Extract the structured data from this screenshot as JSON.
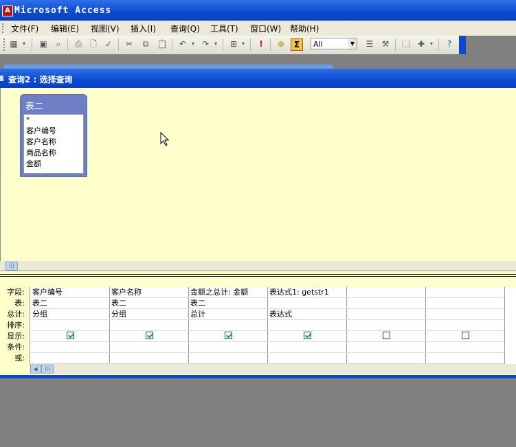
{
  "app": {
    "title": "Microsoft Access",
    "icon": "access-key-icon"
  },
  "menu": [
    "文件(F)",
    "编辑(E)",
    "视图(V)",
    "插入(I)",
    "查询(Q)",
    "工具(T)",
    "窗口(W)",
    "帮助(H)"
  ],
  "toolbar": {
    "top_values_combo": "All",
    "icons": [
      "view-icon",
      "save-icon",
      "search-icon",
      "print-icon",
      "print-preview-icon",
      "spelling-icon",
      "cut-icon",
      "copy-icon",
      "paste-icon",
      "undo-icon",
      "redo-icon",
      "query-type-icon",
      "run-icon",
      "show-table-icon",
      "totals-icon",
      "properties-icon",
      "build-icon",
      "database-window-icon",
      "new-object-icon",
      "help-icon"
    ]
  },
  "query_window": {
    "title": "查询2 : 选择查询"
  },
  "table_box": {
    "name": "表二",
    "fields": [
      "*",
      "客户编号",
      "客户名称",
      "商品名称",
      "金额"
    ]
  },
  "grid": {
    "row_labels": [
      "字段:",
      "表:",
      "总计:",
      "排序:",
      "显示:",
      "条件:",
      "或:"
    ],
    "columns": [
      {
        "field": "客户编号",
        "table": "表二",
        "total": "分组",
        "sort": "",
        "show": true
      },
      {
        "field": "客户名称",
        "table": "表二",
        "total": "分组",
        "sort": "",
        "show": true
      },
      {
        "field": "金额之总计: 金额",
        "table": "表二",
        "total": "总计",
        "sort": "",
        "show": true
      },
      {
        "field": "表达式1: getstr1",
        "table": "",
        "total": "表达式",
        "sort": "",
        "show": true
      },
      {
        "field": "",
        "table": "",
        "total": "",
        "sort": "",
        "show": false
      },
      {
        "field": "",
        "table": "",
        "total": "",
        "sort": "",
        "show": false
      }
    ]
  }
}
